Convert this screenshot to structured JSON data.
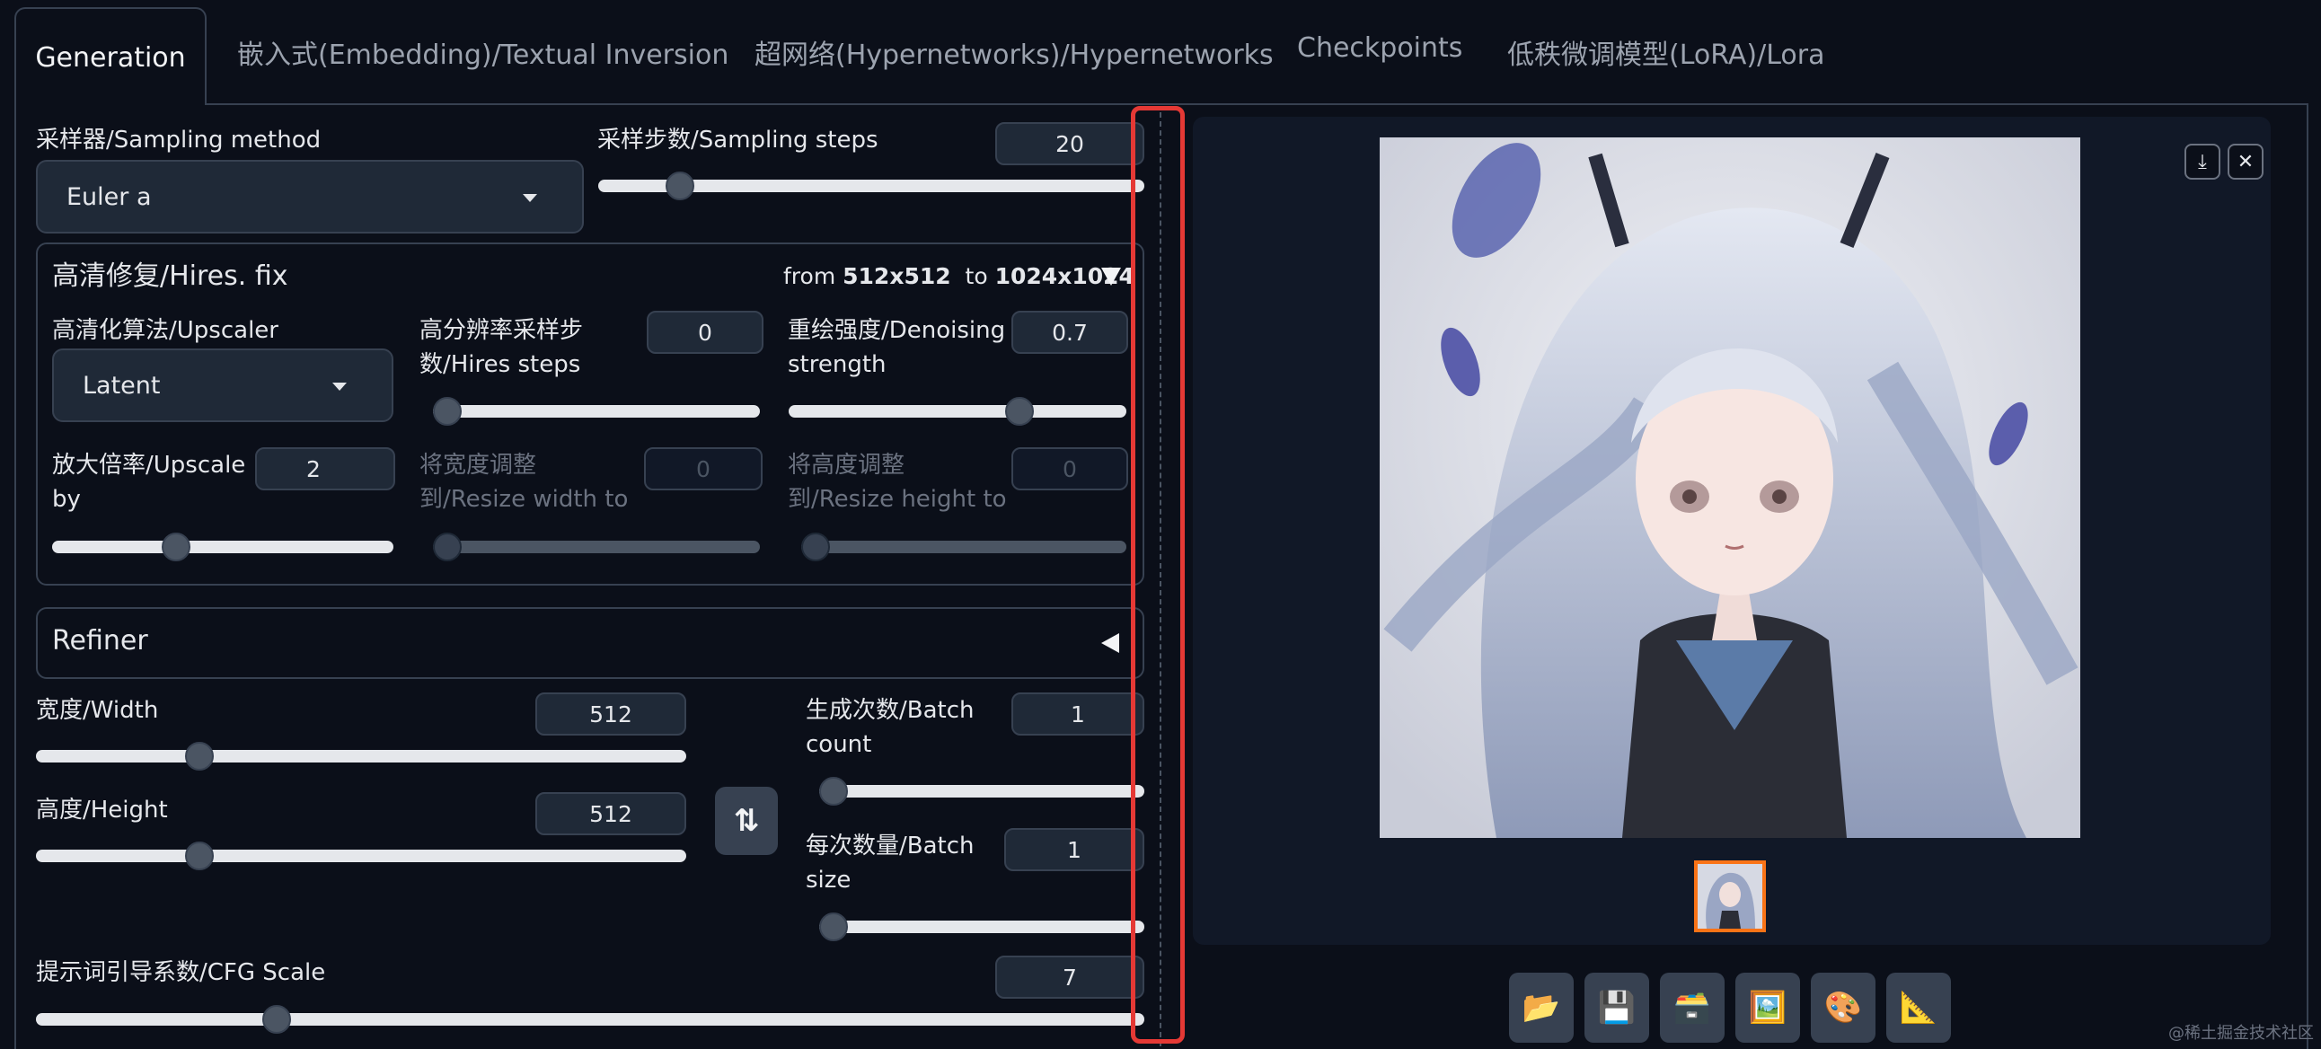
{
  "tabs": [
    {
      "label": "Generation",
      "active": true
    },
    {
      "label": "嵌入式(Embedding)/Textual Inversion"
    },
    {
      "label": "超网络(Hypernetworks)/Hypernetworks"
    },
    {
      "label": "Checkpoints"
    },
    {
      "label": "低秩微调模型(LoRA)/Lora"
    }
  ],
  "sampler": {
    "label": "采样器/Sampling method",
    "value": "Euler a"
  },
  "steps": {
    "label": "采样步数/Sampling steps",
    "value": "20",
    "fraction": 0.13
  },
  "hires": {
    "title": "高清修复/Hires. fix",
    "from_prefix": "from",
    "from_size": "512x512",
    "to_prefix": "to",
    "to_size": "1024x1024",
    "upscaler": {
      "label": "高清化算法/Upscaler",
      "value": "Latent"
    },
    "hires_steps": {
      "label_line1": "高分辨率采样步",
      "label_line2": "数/Hires steps",
      "value": "0",
      "fraction": 0.0
    },
    "denoising": {
      "label_line1": "重绘强度/Denoising",
      "label_line2": "strength",
      "value": "0.7",
      "fraction": 0.7
    },
    "upscale_by": {
      "label_line1": "放大倍率/Upscale",
      "label_line2": "by",
      "value": "2",
      "fraction": 0.35
    },
    "resize_width": {
      "label_line1": "将宽度调整",
      "label_line2": "到/Resize width to",
      "value": "0",
      "fraction": 0.0
    },
    "resize_height": {
      "label_line1": "将高度调整",
      "label_line2": "到/Resize height to",
      "value": "0",
      "fraction": 0.0
    }
  },
  "refiner": {
    "title": "Refiner"
  },
  "width": {
    "label": "宽度/Width",
    "value": "512",
    "fraction": 0.24
  },
  "height": {
    "label": "高度/Height",
    "value": "512",
    "fraction": 0.24
  },
  "batch_count": {
    "label_line1": "生成次数/Batch",
    "label_line2": "count",
    "value": "1",
    "fraction": 0.0
  },
  "batch_size": {
    "label_line1": "每次数量/Batch",
    "label_line2": "size",
    "value": "1",
    "fraction": 0.0
  },
  "cfg": {
    "label": "提示词引导系数/CFG Scale",
    "value": "7",
    "fraction": 0.21
  },
  "toolbar_icons": [
    "folder-icon",
    "save-icon",
    "zip-icon",
    "image-icon",
    "palette-icon",
    "ruler-icon"
  ],
  "watermark": "@稀土掘金技术社区",
  "colors": {
    "accent_red": "#e53935",
    "thumb_border": "#f97316",
    "bg": "#0b0f19"
  }
}
